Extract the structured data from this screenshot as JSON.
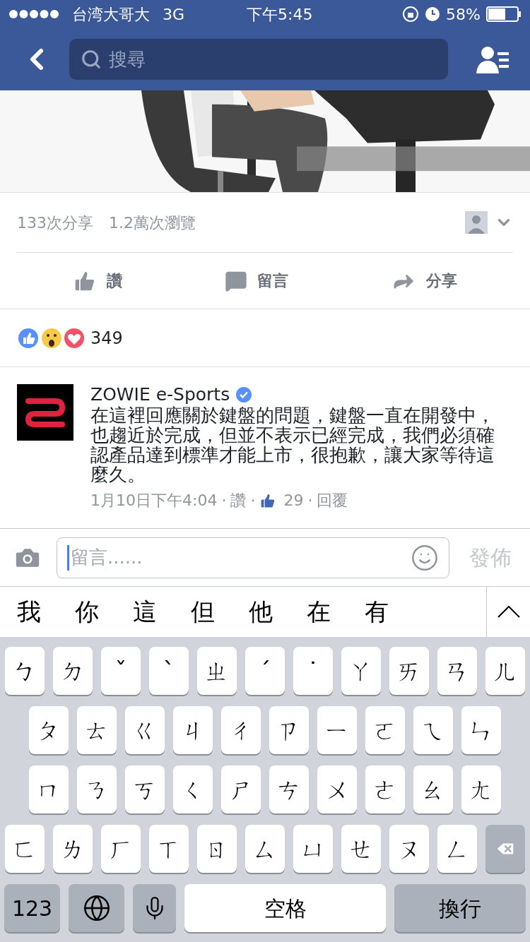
{
  "status_bar": {
    "carrier": "台湾大哥大",
    "network": "3G",
    "time": "下午5:45",
    "battery": "58%"
  },
  "nav": {
    "search_placeholder": "搜尋"
  },
  "stats": {
    "shares": "133次分享",
    "views": "1.2萬次瀏覽"
  },
  "actions": [
    {
      "kind": "like",
      "label": "讚"
    },
    {
      "kind": "comment",
      "label": "留言"
    },
    {
      "kind": "share",
      "label": "分享"
    }
  ],
  "reactions": {
    "count": "349"
  },
  "comment": {
    "author": "ZOWIE e-Sports",
    "verified": true,
    "text": "在這裡回應關於鍵盤的問題，鍵盤一直在開發中，也趨近於完成，但並不表示已經完成，我們必須確認產品達到標準才能上市，很抱歉，讓大家等待這麼久。",
    "meta": [
      {
        "kind": "text",
        "text": "1月10日下午4:04"
      },
      {
        "kind": "sep",
        "text": "·"
      },
      {
        "kind": "link",
        "text": "讚"
      },
      {
        "kind": "sep",
        "text": "·"
      },
      {
        "kind": "likes",
        "text": "29"
      },
      {
        "kind": "sep",
        "text": "·"
      },
      {
        "kind": "link",
        "text": "回覆"
      }
    ]
  },
  "composer": {
    "placeholder": "留言......",
    "submit": "發佈",
    "submit_disabled": true
  },
  "candidates": [
    "我",
    "你",
    "這",
    "但",
    "他",
    "在",
    "有"
  ],
  "keyboard": {
    "rows": [
      {
        "keys": [
          {
            "kind": "key",
            "label": "ㄅ"
          },
          {
            "kind": "key",
            "label": "ㄉ"
          },
          {
            "kind": "key",
            "label": "ˇ"
          },
          {
            "kind": "key",
            "label": "ˋ"
          },
          {
            "kind": "key",
            "label": "ㄓ"
          },
          {
            "kind": "key",
            "label": "ˊ"
          },
          {
            "kind": "key",
            "label": "˙"
          },
          {
            "kind": "key",
            "label": "ㄚ"
          },
          {
            "kind": "key",
            "label": "ㄞ"
          },
          {
            "kind": "key",
            "label": "ㄢ"
          },
          {
            "kind": "key",
            "label": "ㄦ"
          }
        ]
      },
      {
        "keys": [
          {
            "kind": "key",
            "label": "ㄆ"
          },
          {
            "kind": "key",
            "label": "ㄊ"
          },
          {
            "kind": "key",
            "label": "ㄍ"
          },
          {
            "kind": "key",
            "label": "ㄐ"
          },
          {
            "kind": "key",
            "label": "ㄔ"
          },
          {
            "kind": "key",
            "label": "ㄗ"
          },
          {
            "kind": "key",
            "label": "ㄧ"
          },
          {
            "kind": "key",
            "label": "ㄛ"
          },
          {
            "kind": "key",
            "label": "ㄟ"
          },
          {
            "kind": "key",
            "label": "ㄣ"
          }
        ]
      },
      {
        "keys": [
          {
            "kind": "key",
            "label": "ㄇ"
          },
          {
            "kind": "key",
            "label": "ㄋ"
          },
          {
            "kind": "key",
            "label": "ㄎ"
          },
          {
            "kind": "key",
            "label": "ㄑ"
          },
          {
            "kind": "key",
            "label": "ㄕ"
          },
          {
            "kind": "key",
            "label": "ㄘ"
          },
          {
            "kind": "key",
            "label": "ㄨ"
          },
          {
            "kind": "key",
            "label": "ㄜ"
          },
          {
            "kind": "key",
            "label": "ㄠ"
          },
          {
            "kind": "key",
            "label": "ㄤ"
          }
        ]
      },
      {
        "keys": [
          {
            "kind": "key",
            "label": "ㄈ"
          },
          {
            "kind": "key",
            "label": "ㄌ"
          },
          {
            "kind": "key",
            "label": "ㄏ"
          },
          {
            "kind": "key",
            "label": "ㄒ"
          },
          {
            "kind": "key",
            "label": "ㄖ"
          },
          {
            "kind": "key",
            "label": "ㄙ"
          },
          {
            "kind": "key",
            "label": "ㄩ"
          },
          {
            "kind": "key",
            "label": "ㄝ"
          },
          {
            "kind": "key",
            "label": "ㄡ"
          },
          {
            "kind": "key",
            "label": "ㄥ"
          },
          {
            "kind": "delete"
          }
        ]
      }
    ],
    "bottom_row": {
      "keys": [
        {
          "kind": "mode",
          "label": "123"
        },
        {
          "kind": "globe"
        },
        {
          "kind": "mic"
        },
        {
          "kind": "space",
          "label": "空格"
        },
        {
          "kind": "return",
          "label": "換行"
        }
      ]
    }
  }
}
